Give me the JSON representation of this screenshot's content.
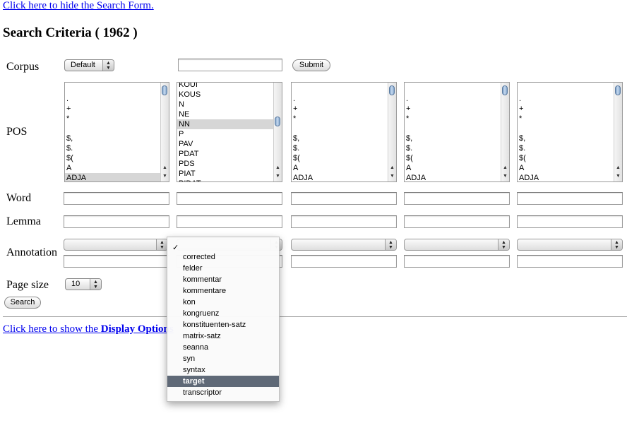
{
  "links": {
    "hide_search": "Click here to hide the Search Form.",
    "show_display_prefix": "Click here to show the ",
    "show_display_bold": "Display Options"
  },
  "title": "Search Criteria ( 1962 )",
  "labels": {
    "corpus": "Corpus",
    "pos": "POS",
    "word": "Word",
    "lemma": "Lemma",
    "annotation": "Annotation",
    "page_size": "Page size"
  },
  "corpus": {
    "selected": "Default",
    "submit_label": "Submit",
    "text_value": ""
  },
  "pos_lists": [
    {
      "items": [
        ".",
        "+",
        "*",
        "",
        "$,",
        "$.",
        "$(",
        "A",
        "ADJA"
      ],
      "selected": "ADJA"
    },
    {
      "items": [
        "KOUI",
        "KOUS",
        "N",
        "NE",
        "NN",
        "P",
        "PAV",
        "PDAT",
        "PDS",
        "PIAT",
        "PIDAT"
      ],
      "selected": "NN"
    },
    {
      "items": [
        ".",
        "+",
        "*",
        "",
        "$,",
        "$.",
        "$(",
        "A",
        "ADJA"
      ],
      "selected": ""
    },
    {
      "items": [
        ".",
        "+",
        "*",
        "",
        "$,",
        "$.",
        "$(",
        "A",
        "ADJA"
      ],
      "selected": ""
    },
    {
      "items": [
        ".",
        "+",
        "*",
        "",
        "$,",
        "$.",
        "$(",
        "A",
        "ADJA"
      ],
      "selected": ""
    }
  ],
  "page_size": {
    "selected": "10"
  },
  "search_label": "Search",
  "annotation_menu": {
    "checked": "",
    "check_mark": "✓",
    "items": [
      "corrected",
      "felder",
      "kommentar",
      "kommentare",
      "kon",
      "kongruenz",
      "konstituenten-satz",
      "matrix-satz",
      "seanna",
      "syn",
      "syntax",
      "target",
      "transcriptor"
    ],
    "highlighted": "target"
  },
  "colors": {
    "link": "#0000ee",
    "menu_highlight": "#5f6977",
    "list_selection": "#d6d6d6"
  },
  "icons": [
    "popup-arrows-icon",
    "scroll-up-icon",
    "scroll-down-icon",
    "checkmark-icon"
  ]
}
